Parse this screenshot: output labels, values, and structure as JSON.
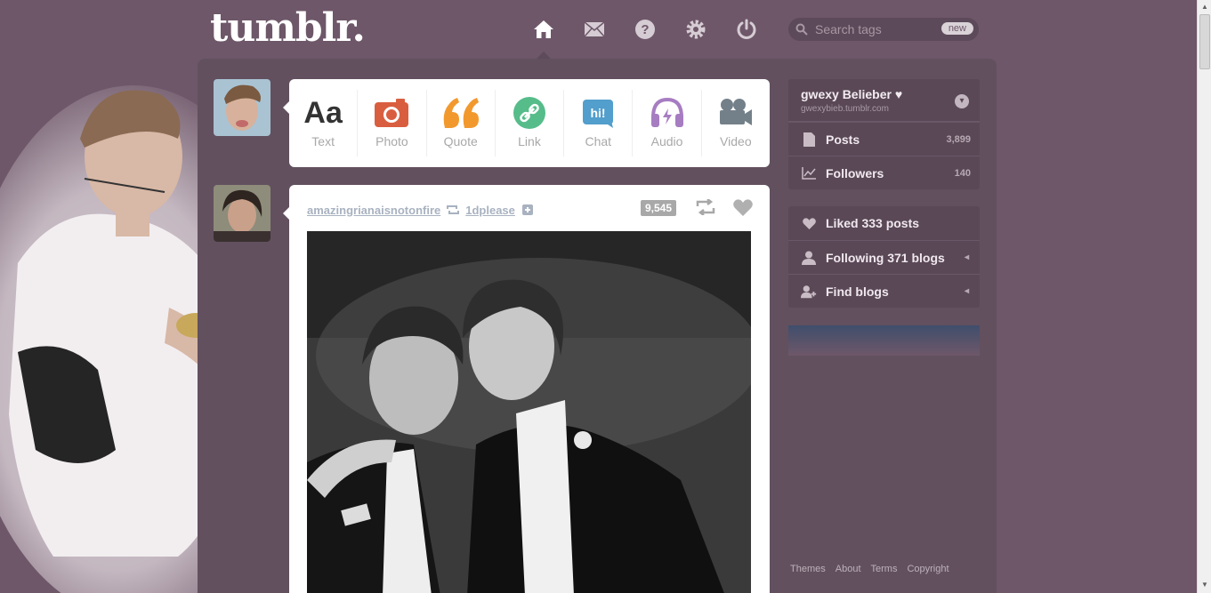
{
  "header": {
    "logo": "tumblr.",
    "nav": [
      {
        "name": "dashboard-home",
        "icon": "home-icon"
      },
      {
        "name": "messages",
        "icon": "envelope-icon"
      },
      {
        "name": "help",
        "icon": "question-icon"
      },
      {
        "name": "settings",
        "icon": "gear-icon"
      },
      {
        "name": "logout",
        "icon": "power-icon"
      }
    ],
    "search": {
      "placeholder": "Search tags",
      "badge": "new"
    }
  },
  "post_types": [
    {
      "label": "Text",
      "glyph": "Aa",
      "color": "#333333"
    },
    {
      "label": "Photo",
      "color": "#d95e40"
    },
    {
      "label": "Quote",
      "glyph": "66",
      "color": "#f2992e"
    },
    {
      "label": "Link",
      "color": "#56bc8a"
    },
    {
      "label": "Chat",
      "glyph": "hi!",
      "color": "#529ecc"
    },
    {
      "label": "Audio",
      "color": "#a77dc2"
    },
    {
      "label": "Video",
      "color": "#748089"
    }
  ],
  "post": {
    "author": "amazingrianaisnotonfire",
    "reblogged_from": "1dplease",
    "notes": "9,545"
  },
  "sidebar": {
    "blog": {
      "name": "gwexy Belieber ♥",
      "url": "gwexybieb.tumblr.com"
    },
    "stats": [
      {
        "label": "Posts",
        "count": "3,899",
        "icon": "document-icon"
      },
      {
        "label": "Followers",
        "count": "140",
        "icon": "chart-icon"
      }
    ],
    "links": [
      {
        "label": "Liked 333 posts",
        "icon": "heart-icon"
      },
      {
        "label": "Following 371 blogs",
        "icon": "person-icon"
      },
      {
        "label": "Find blogs",
        "icon": "person-add-icon"
      }
    ]
  },
  "footer": [
    "Themes",
    "About",
    "Terms",
    "Copyright"
  ],
  "colors": {
    "background": "#6e5769",
    "panel": "#5a4857",
    "link": "#a8b2c0"
  }
}
